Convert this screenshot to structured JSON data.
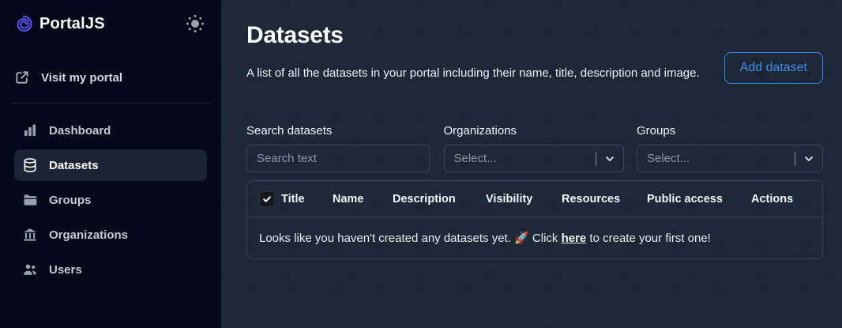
{
  "app": {
    "name": "PortalJS"
  },
  "sidebar": {
    "portal_link_label": "Visit my portal",
    "items": [
      {
        "label": "Dashboard",
        "icon": "bar-chart-icon",
        "active": false
      },
      {
        "label": "Datasets",
        "icon": "database-icon",
        "active": true
      },
      {
        "label": "Groups",
        "icon": "folder-icon",
        "active": false
      },
      {
        "label": "Organizations",
        "icon": "bank-icon",
        "active": false
      },
      {
        "label": "Users",
        "icon": "users-icon",
        "active": false
      }
    ]
  },
  "main": {
    "title": "Datasets",
    "description": "A list of all the datasets in your portal including their name, title, description and image.",
    "add_button_label": "Add dataset",
    "filters": {
      "search": {
        "label": "Search datasets",
        "placeholder": "Search text",
        "value": ""
      },
      "organizations": {
        "label": "Organizations",
        "placeholder": "Select..."
      },
      "groups": {
        "label": "Groups",
        "placeholder": "Select..."
      }
    },
    "table": {
      "columns": [
        "Title",
        "Name",
        "Description",
        "Visibility",
        "Resources",
        "Public access",
        "Actions"
      ],
      "select_all_checked": true,
      "empty_state": {
        "text_before": "Looks like you haven't created any datasets yet. 🚀 Click ",
        "link_text": "here",
        "text_after": " to create your first one!"
      }
    }
  },
  "colors": {
    "accent_blue": "#3b82f6",
    "logo_indigo": "#544de4",
    "sidebar_bg": "#040818",
    "main_bg": "#1e2938"
  }
}
